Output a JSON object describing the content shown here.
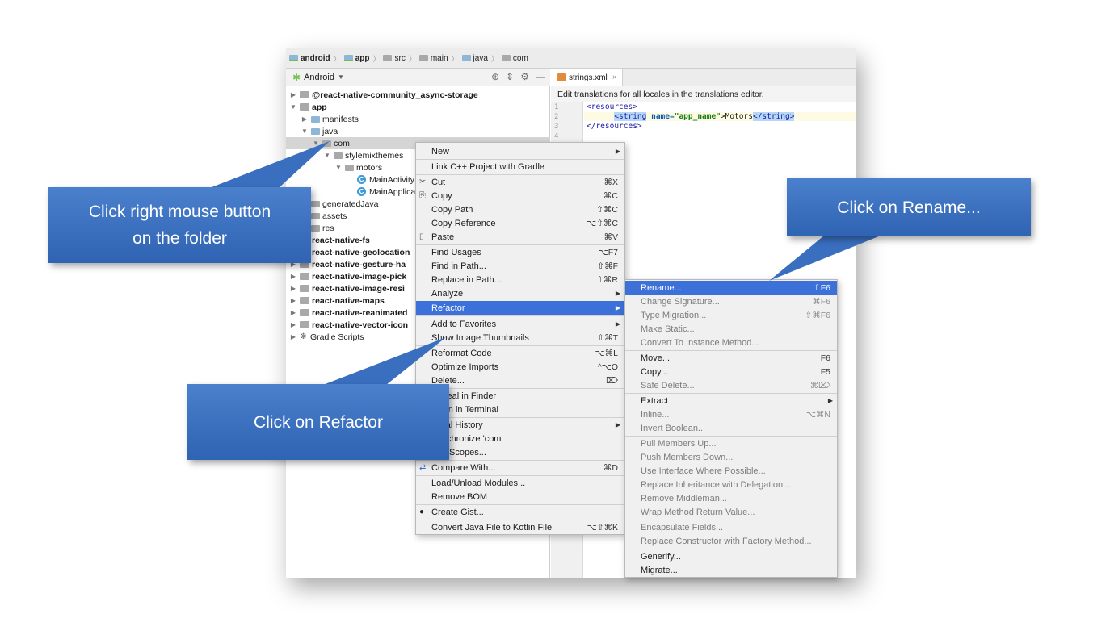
{
  "breadcrumb": [
    "android",
    "app",
    "src",
    "main",
    "java",
    "com"
  ],
  "project_panel": {
    "title": "Android"
  },
  "tree": [
    {
      "label": "@react-native-community_async-storage",
      "bold": true,
      "arrow": "▶",
      "icon": "module"
    },
    {
      "label": "app",
      "bold": true,
      "arrow": "▼",
      "icon": "module"
    },
    {
      "label": "manifests",
      "bold": false,
      "arrow": "▶",
      "icon": "folder"
    },
    {
      "label": "java",
      "bold": false,
      "arrow": "▼",
      "icon": "folder"
    },
    {
      "label": "com",
      "bold": false,
      "arrow": "▼",
      "icon": "package"
    },
    {
      "label": "stylemixthemes",
      "bold": false,
      "arrow": "▼",
      "icon": "package"
    },
    {
      "label": "motors",
      "bold": false,
      "arrow": "▼",
      "icon": "package"
    },
    {
      "label": "MainActivity",
      "bold": false,
      "arrow": "",
      "icon": "class"
    },
    {
      "label": "MainApplica",
      "bold": false,
      "arrow": "",
      "icon": "class"
    },
    {
      "label": "generatedJava",
      "bold": false,
      "arrow": "",
      "icon": "folder"
    },
    {
      "label": "assets",
      "bold": false,
      "arrow": "",
      "icon": "folder"
    },
    {
      "label": "res",
      "bold": false,
      "arrow": "",
      "icon": "folder"
    },
    {
      "label": "react-native-fs",
      "bold": true,
      "arrow": "",
      "icon": "module"
    },
    {
      "label": "react-native-geolocation",
      "bold": true,
      "arrow": "",
      "icon": "module"
    },
    {
      "label": "react-native-gesture-ha",
      "bold": true,
      "arrow": "▶",
      "icon": "module"
    },
    {
      "label": "react-native-image-pick",
      "bold": true,
      "arrow": "▶",
      "icon": "module"
    },
    {
      "label": "react-native-image-resi",
      "bold": true,
      "arrow": "▶",
      "icon": "module"
    },
    {
      "label": "react-native-maps",
      "bold": true,
      "arrow": "▶",
      "icon": "module"
    },
    {
      "label": "react-native-reanimated",
      "bold": true,
      "arrow": "▶",
      "icon": "module"
    },
    {
      "label": "react-native-vector-icon",
      "bold": true,
      "arrow": "▶",
      "icon": "module"
    },
    {
      "label": "Gradle Scripts",
      "bold": false,
      "arrow": "▶",
      "icon": "gradle"
    }
  ],
  "editor": {
    "tab": "strings.xml",
    "notice": "Edit translations for all locales in the translations editor.",
    "line_numbers": [
      "1",
      "2",
      "3",
      "4"
    ],
    "code": {
      "l1": "<resources>",
      "l2_open": "<string",
      "l2_attr": "name=",
      "l2_val": "\"app_name\"",
      "l2_text": ">Motors",
      "l2_close": "</string>",
      "l3": "</resources>"
    }
  },
  "context_menu": [
    {
      "label": "New",
      "shortcut": "",
      "submenu": true
    },
    {
      "label": "Link C++ Project with Gradle",
      "shortcut": "",
      "sep_before": true
    },
    {
      "label": "Cut",
      "shortcut": "⌘X",
      "icon": "✂",
      "sep_before": true
    },
    {
      "label": "Copy",
      "shortcut": "⌘C",
      "icon": "⎘"
    },
    {
      "label": "Copy Path",
      "shortcut": "⇧⌘C"
    },
    {
      "label": "Copy Reference",
      "shortcut": "⌥⇧⌘C"
    },
    {
      "label": "Paste",
      "shortcut": "⌘V",
      "icon": "📋"
    },
    {
      "label": "Find Usages",
      "shortcut": "⌥F7",
      "sep_before": true
    },
    {
      "label": "Find in Path...",
      "shortcut": "⇧⌘F"
    },
    {
      "label": "Replace in Path...",
      "shortcut": "⇧⌘R"
    },
    {
      "label": "Analyze",
      "shortcut": "",
      "submenu": true
    },
    {
      "label": "Refactor",
      "shortcut": "",
      "submenu": true,
      "highlight": true
    },
    {
      "label": "Add to Favorites",
      "shortcut": "",
      "submenu": true,
      "sep_before": true
    },
    {
      "label": "Show Image Thumbnails",
      "shortcut": "⇧⌘T"
    },
    {
      "label": "Reformat Code",
      "shortcut": "⌥⌘L",
      "sep_before": true
    },
    {
      "label": "Optimize Imports",
      "shortcut": "^⌥O"
    },
    {
      "label": "Delete...",
      "shortcut": "⌦"
    },
    {
      "label": "Reveal in Finder",
      "shortcut": "",
      "sep_before": true
    },
    {
      "label": "Open in Terminal",
      "shortcut": ""
    },
    {
      "label": "Local History",
      "shortcut": "",
      "submenu": true,
      "sep_before": true
    },
    {
      "label": "Synchronize 'com'",
      "shortcut": ""
    },
    {
      "label": "Edit Scopes...",
      "shortcut": ""
    },
    {
      "label": "Compare With...",
      "shortcut": "⌘D",
      "icon": "⇄",
      "sep_before": true
    },
    {
      "label": "Load/Unload Modules...",
      "shortcut": "",
      "sep_before": true
    },
    {
      "label": "Remove BOM",
      "shortcut": ""
    },
    {
      "label": "Create Gist...",
      "shortcut": "",
      "icon": "●",
      "sep_before": true
    },
    {
      "label": "Convert Java File to Kotlin File",
      "shortcut": "⌥⇧⌘K",
      "sep_before": true
    }
  ],
  "refactor_menu": [
    {
      "label": "Rename...",
      "shortcut": "⇧F6",
      "highlight": true
    },
    {
      "label": "Change Signature...",
      "shortcut": "⌘F6",
      "disabled": true
    },
    {
      "label": "Type Migration...",
      "shortcut": "⇧⌘F6",
      "disabled": true
    },
    {
      "label": "Make Static...",
      "shortcut": "",
      "disabled": true
    },
    {
      "label": "Convert To Instance Method...",
      "shortcut": "",
      "disabled": true
    },
    {
      "label": "Move...",
      "shortcut": "F6",
      "sep_before": true
    },
    {
      "label": "Copy...",
      "shortcut": "F5"
    },
    {
      "label": "Safe Delete...",
      "shortcut": "⌘⌦",
      "disabled": true
    },
    {
      "label": "Extract",
      "shortcut": "",
      "submenu": true,
      "sep_before": true
    },
    {
      "label": "Inline...",
      "shortcut": "⌥⌘N",
      "disabled": true
    },
    {
      "label": "Invert Boolean...",
      "shortcut": "",
      "disabled": true
    },
    {
      "label": "Pull Members Up...",
      "shortcut": "",
      "disabled": true,
      "sep_before": true
    },
    {
      "label": "Push Members Down...",
      "shortcut": "",
      "disabled": true
    },
    {
      "label": "Use Interface Where Possible...",
      "shortcut": "",
      "disabled": true
    },
    {
      "label": "Replace Inheritance with Delegation...",
      "shortcut": "",
      "disabled": true
    },
    {
      "label": "Remove Middleman...",
      "shortcut": "",
      "disabled": true
    },
    {
      "label": "Wrap Method Return Value...",
      "shortcut": "",
      "disabled": true
    },
    {
      "label": "Encapsulate Fields...",
      "shortcut": "",
      "disabled": true,
      "sep_before": true
    },
    {
      "label": "Replace Constructor with Factory Method...",
      "shortcut": "",
      "disabled": true
    },
    {
      "label": "Generify...",
      "shortcut": "",
      "sep_before": true
    },
    {
      "label": "Migrate...",
      "shortcut": ""
    }
  ],
  "callouts": {
    "right_click": [
      "Click right mouse button",
      "on the folder"
    ],
    "refactor": "Click on Refactor",
    "rename": "Click on Rename..."
  },
  "colors": {
    "callout": "#3a70c0",
    "menu_highlight": "#3b71d8",
    "menu_bg": "#f0f0f0"
  }
}
